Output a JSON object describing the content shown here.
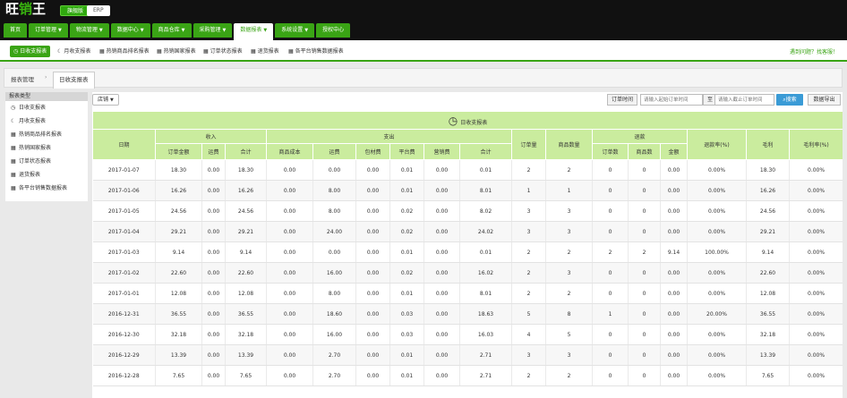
{
  "app": {
    "logo_part1": "旺",
    "logo_part2": "销",
    "logo_part3": "王",
    "mode_active": "旗舰版",
    "mode_erp": "ERP"
  },
  "main_nav": [
    {
      "label": "首页",
      "caret": false
    },
    {
      "label": "订单管理",
      "caret": true
    },
    {
      "label": "物流管理",
      "caret": true
    },
    {
      "label": "数据中心",
      "caret": true
    },
    {
      "label": "商品仓库",
      "caret": true
    },
    {
      "label": "采购管理",
      "caret": true
    },
    {
      "label": "数据报表",
      "caret": true,
      "active": true
    },
    {
      "label": "系统设置",
      "caret": true
    },
    {
      "label": "授权中心",
      "caret": false
    }
  ],
  "sub_nav": [
    {
      "label": "日收支报表",
      "icon": "clock-icon",
      "active": true
    },
    {
      "label": "月收支报表",
      "icon": "moon-icon"
    },
    {
      "label": "热销商品排名报表",
      "icon": "grid-icon"
    },
    {
      "label": "热销国家报表",
      "icon": "grid-icon"
    },
    {
      "label": "订单状态报表",
      "icon": "grid-icon"
    },
    {
      "label": "退货报表",
      "icon": "grid-icon"
    },
    {
      "label": "各平台销售数据报表",
      "icon": "grid-icon"
    }
  ],
  "help_text": "遇到问题？找客服！",
  "breadcrumb": {
    "root": "报表管理",
    "current_tab": "日收支报表"
  },
  "sidebar": {
    "header": "报表类型",
    "items": [
      {
        "label": "日收支报表",
        "icon": "clock-icon"
      },
      {
        "label": "月收支报表",
        "icon": "moon-icon"
      },
      {
        "label": "热销商品排名报表",
        "icon": "grid-icon"
      },
      {
        "label": "热销国家报表",
        "icon": "grid-icon"
      },
      {
        "label": "订单状态报表",
        "icon": "grid-icon"
      },
      {
        "label": "退货报表",
        "icon": "grid-icon"
      },
      {
        "label": "各平台销售数据报表",
        "icon": "grid-icon"
      }
    ]
  },
  "toolbar": {
    "shop_label": "店铺",
    "order_time_label": "订单时间",
    "start_placeholder": "请输入起始订单时间",
    "separator": "至",
    "end_placeholder": "请输入截止订单时间",
    "search_label": "搜索",
    "export_label": "数据导出"
  },
  "report": {
    "title": "日收支报表",
    "group_headers": {
      "date": "日期",
      "income": "收入",
      "expense": "支出",
      "order_count": "订单量",
      "product_count": "商品数量",
      "refund": "退款",
      "refund_rate": "退款率(%)",
      "gross_profit": "毛利",
      "gross_margin": "毛利率(%)"
    },
    "sub_headers": {
      "income": [
        "订单金额",
        "运费",
        "合计"
      ],
      "expense": [
        "商品成本",
        "运费",
        "包材费",
        "平台费",
        "营销费",
        "合计"
      ],
      "refund": [
        "订单数",
        "商品数",
        "金额"
      ]
    },
    "rows": [
      [
        "2017-01-07",
        "18.30",
        "0.00",
        "18.30",
        "0.00",
        "0.00",
        "0.00",
        "0.01",
        "0.00",
        "0.01",
        "2",
        "2",
        "0",
        "0",
        "0.00",
        "0.00%",
        "18.30",
        "0.00%"
      ],
      [
        "2017-01-06",
        "16.26",
        "0.00",
        "16.26",
        "0.00",
        "8.00",
        "0.00",
        "0.01",
        "0.00",
        "8.01",
        "1",
        "1",
        "0",
        "0",
        "0.00",
        "0.00%",
        "16.26",
        "0.00%"
      ],
      [
        "2017-01-05",
        "24.56",
        "0.00",
        "24.56",
        "0.00",
        "8.00",
        "0.00",
        "0.02",
        "0.00",
        "8.02",
        "3",
        "3",
        "0",
        "0",
        "0.00",
        "0.00%",
        "24.56",
        "0.00%"
      ],
      [
        "2017-01-04",
        "29.21",
        "0.00",
        "29.21",
        "0.00",
        "24.00",
        "0.00",
        "0.02",
        "0.00",
        "24.02",
        "3",
        "3",
        "0",
        "0",
        "0.00",
        "0.00%",
        "29.21",
        "0.00%"
      ],
      [
        "2017-01-03",
        "9.14",
        "0.00",
        "9.14",
        "0.00",
        "0.00",
        "0.00",
        "0.01",
        "0.00",
        "0.01",
        "2",
        "2",
        "2",
        "2",
        "9.14",
        "100.00%",
        "9.14",
        "0.00%"
      ],
      [
        "2017-01-02",
        "22.60",
        "0.00",
        "22.60",
        "0.00",
        "16.00",
        "0.00",
        "0.02",
        "0.00",
        "16.02",
        "2",
        "3",
        "0",
        "0",
        "0.00",
        "0.00%",
        "22.60",
        "0.00%"
      ],
      [
        "2017-01-01",
        "12.08",
        "0.00",
        "12.08",
        "0.00",
        "8.00",
        "0.00",
        "0.01",
        "0.00",
        "8.01",
        "2",
        "2",
        "0",
        "0",
        "0.00",
        "0.00%",
        "12.08",
        "0.00%"
      ],
      [
        "2016-12-31",
        "36.55",
        "0.00",
        "36.55",
        "0.00",
        "18.60",
        "0.00",
        "0.03",
        "0.00",
        "18.63",
        "5",
        "8",
        "1",
        "0",
        "0.00",
        "20.00%",
        "36.55",
        "0.00%"
      ],
      [
        "2016-12-30",
        "32.18",
        "0.00",
        "32.18",
        "0.00",
        "16.00",
        "0.00",
        "0.03",
        "0.00",
        "16.03",
        "4",
        "5",
        "0",
        "0",
        "0.00",
        "0.00%",
        "32.18",
        "0.00%"
      ],
      [
        "2016-12-29",
        "13.39",
        "0.00",
        "13.39",
        "0.00",
        "2.70",
        "0.00",
        "0.01",
        "0.00",
        "2.71",
        "3",
        "3",
        "0",
        "0",
        "0.00",
        "0.00%",
        "13.39",
        "0.00%"
      ],
      [
        "2016-12-28",
        "7.65",
        "0.00",
        "7.65",
        "0.00",
        "2.70",
        "0.00",
        "0.01",
        "0.00",
        "2.71",
        "2",
        "2",
        "0",
        "0",
        "0.00",
        "0.00%",
        "7.65",
        "0.00%"
      ]
    ]
  },
  "colors": {
    "brand_green": "#3aa415",
    "header_green": "#caec9e",
    "search_blue": "#3a9bd6"
  }
}
